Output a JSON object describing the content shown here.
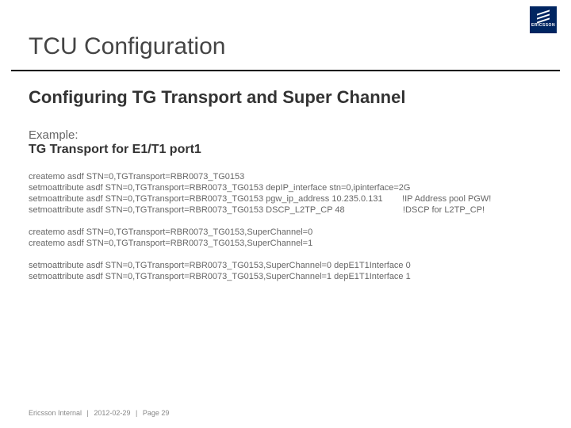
{
  "brand": {
    "name": "ERICSSON"
  },
  "title": "TCU Configuration",
  "subtitle": "Configuring TG Transport and Super Channel",
  "example_label": "Example:",
  "section_label": "TG Transport for E1/T1 port1",
  "code": "createmo asdf STN=0,TGTransport=RBR0073_TG0153\nsetmoattribute asdf STN=0,TGTransport=RBR0073_TG0153 depIP_interface stn=0,ipinterface=2G\nsetmoattribute asdf STN=0,TGTransport=RBR0073_TG0153 pgw_ip_address 10.235.0.131        !IP Address pool PGW!\nsetmoattribute asdf STN=0,TGTransport=RBR0073_TG0153 DSCP_L2TP_CP 48                        !DSCP for L2TP_CP!\n\ncreatemo asdf STN=0,TGTransport=RBR0073_TG0153,SuperChannel=0\ncreatemo asdf STN=0,TGTransport=RBR0073_TG0153,SuperChannel=1\n\nsetmoattribute asdf STN=0,TGTransport=RBR0073_TG0153,SuperChannel=0 depE1T1Interface 0\nsetmoattribute asdf STN=0,TGTransport=RBR0073_TG0153,SuperChannel=1 depE1T1Interface 1",
  "footer": {
    "classification": "Ericsson Internal",
    "date": "2012-02-29",
    "page": "Page 29"
  }
}
